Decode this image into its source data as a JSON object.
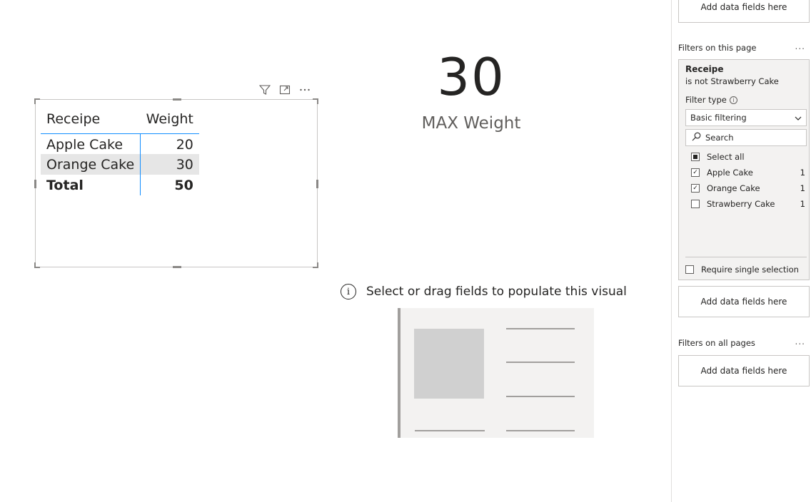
{
  "table": {
    "headers": [
      "Receipe",
      "Weight"
    ],
    "rows": [
      {
        "recipe": "Apple Cake",
        "weight": "20"
      },
      {
        "recipe": "Orange Cake",
        "weight": "30"
      }
    ],
    "total": {
      "label": "Total",
      "value": "50"
    }
  },
  "card": {
    "value": "30",
    "label": "MAX Weight"
  },
  "empty_visual": {
    "message": "Select or drag fields to populate this visual"
  },
  "filter_pane": {
    "top_drop": "Add data fields here",
    "page_section_title": "Filters on this page",
    "page_section_more": "...",
    "filter": {
      "field": "Receipe",
      "condition": "is not Strawberry Cake",
      "type_label": "Filter type",
      "type_value": "Basic filtering",
      "search_placeholder": "Search",
      "select_all": "Select all",
      "options": [
        {
          "label": "Apple Cake",
          "count": "1",
          "checked": true
        },
        {
          "label": "Orange Cake",
          "count": "1",
          "checked": true
        },
        {
          "label": "Strawberry Cake",
          "count": "1",
          "checked": false
        }
      ],
      "require_single": "Require single selection"
    },
    "page_drop": "Add data fields here",
    "all_section_title": "Filters on all pages",
    "all_section_more": "...",
    "all_drop": "Add data fields here"
  },
  "icons": {
    "filter": "filter-icon",
    "focus": "focus-mode-icon",
    "more": "more-options-icon",
    "info": "info-icon",
    "search": "search-icon",
    "chevron": "chevron-down-icon"
  }
}
